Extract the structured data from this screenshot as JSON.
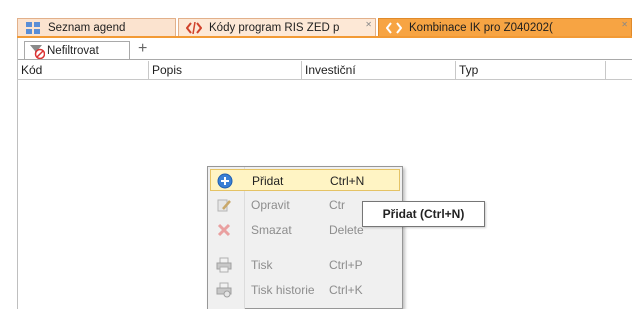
{
  "tabs": [
    {
      "label": "Seznam agend",
      "icon": "grid-icon",
      "active": false
    },
    {
      "label": "Kódy program RIS ZED p",
      "icon": "code-icon",
      "active": false
    },
    {
      "label": "Kombinace IK pro Z040202(",
      "icon": "code-icon",
      "active": true
    }
  ],
  "filter": {
    "tab_label": "Nefiltrovat",
    "tab_icon": "filter-clear-icon",
    "add_label": "+"
  },
  "grid": {
    "columns": [
      "Kód",
      "Popis",
      "Investiční",
      "Typ"
    ]
  },
  "context_menu": {
    "items": [
      {
        "label": "Přidat",
        "shortcut": "Ctrl+N",
        "icon": "plus-circle-icon",
        "state": "highlighted"
      },
      {
        "label": "Opravit",
        "shortcut": "Ctr",
        "icon": "edit-icon",
        "state": "disabled"
      },
      {
        "label": "Smazat",
        "shortcut": "Delete",
        "icon": "delete-icon",
        "state": "disabled"
      },
      {
        "label": "Tisk",
        "shortcut": "Ctrl+P",
        "icon": "print-icon",
        "state": "disabled"
      },
      {
        "label": "Tisk historie",
        "shortcut": "Ctrl+K",
        "icon": "print-history-icon",
        "state": "disabled"
      }
    ]
  },
  "tooltip": {
    "text": "Přidat (Ctrl+N)"
  },
  "colors": {
    "active_tab": "#f7a443",
    "inactive_tab": "#fbe3cf",
    "tab_accent_line": "#f29a35",
    "menu_highlight": "#fff4c4"
  }
}
